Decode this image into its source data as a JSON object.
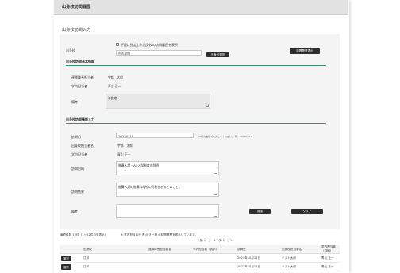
{
  "page": {
    "title": "出身校訪問履歴",
    "section_title": "出身校訪問入力"
  },
  "school": {
    "label": "出身校",
    "checkbox_label": "下記に指定した出身校の訪問履歴を表示",
    "value": "内丸学院",
    "select_button": "出身校選択",
    "history_button": "訪問履歴表示"
  },
  "basic": {
    "heading": "出身校訪問基本情報",
    "officer_label": "連隊隊長担当者",
    "officer_value": "宇都　太郎",
    "internal_label": "学内担当者",
    "internal_value": "青山 正一",
    "note_label": "備考",
    "note_value": "未設定"
  },
  "detail": {
    "heading": "出身校訪問情報入力",
    "date_label": "訪問日",
    "date_value": "20230718",
    "date_hint": "(8桁の数値で入力してください。 例：20080101)",
    "visitor_label": "出身校担当者名",
    "visitor_value": "宇都　太郎",
    "staff_label": "学内担当者",
    "staff_value": "青山 正一",
    "purpose_label": "訪問目的",
    "purpose_value": "推薦入試・AO入試制度の説明",
    "result_label": "訪問結果",
    "result_value": "推薦入試の推薦枠増枠の可能性あるとのこと。",
    "note_label": "備考",
    "note_value": "",
    "register_button": "追加",
    "clear_button": "クリア"
  },
  "history": {
    "summary": "最終件数 12件（1～12件目を表示）",
    "condition": "※ 学内担当者が 青山 正一様 の訪問履歴を表示しています。",
    "pager": "＜前ページ　1　次ページ＞",
    "columns": [
      "",
      "出身校",
      "連隊隊長担当者名",
      "学内担当者（表示）",
      "訪問日",
      "出身校担当者名",
      "学内担当者（詳細）"
    ],
    "rows": [
      {
        "select": "選択",
        "school": "江和",
        "officer": "",
        "internal": "",
        "date": "2023年10月11日",
        "visitor": "テスト太郎",
        "staff": "青山 正一"
      },
      {
        "select": "選択",
        "school": "江和",
        "officer": "",
        "internal": "",
        "date": "2023年10月11日",
        "visitor": "テスト太郎",
        "staff": "青山 正一"
      }
    ]
  }
}
